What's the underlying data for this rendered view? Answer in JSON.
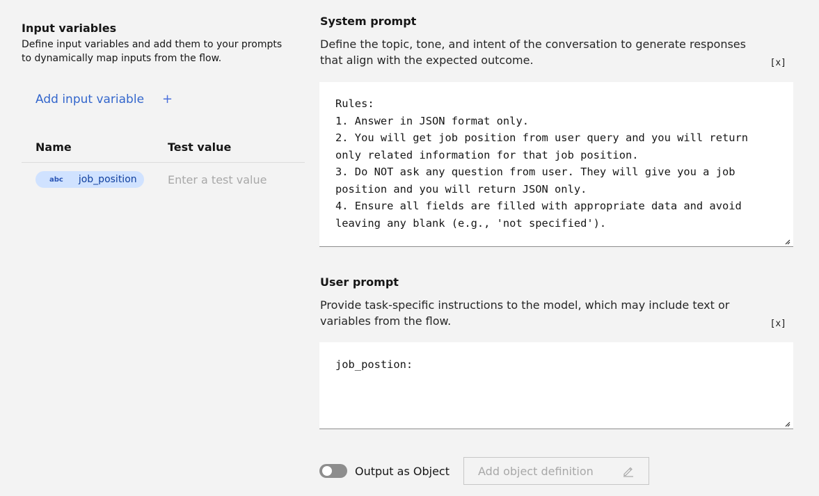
{
  "input_variables": {
    "title": "Input variables",
    "description": "Define input variables and add them to your prompts to dynamically map inputs from the flow.",
    "add_label": "Add input variable",
    "add_icon": "+",
    "columns": {
      "name": "Name",
      "test_value": "Test value"
    },
    "rows": [
      {
        "type_badge": "abc",
        "name": "job_position",
        "test_value_placeholder": "Enter a test value"
      }
    ]
  },
  "system_prompt": {
    "title": "System prompt",
    "description": "Define the topic, tone, and intent of the conversation to generate responses that align with the expected outcome.",
    "variable_icon": "[x]",
    "content": "Rules:\n1. Answer in JSON format only.\n2. You will get job position from user query and you will return only related information for that job position.\n3. Do NOT ask any question from user. They will give you a job position and you will return JSON only.\n4. Ensure all fields are filled with appropriate data and avoid leaving any blank (e.g., 'not specified')."
  },
  "user_prompt": {
    "title": "User prompt",
    "description": "Provide task-specific instructions to the model, which may include text or variables from the flow.",
    "variable_icon": "[x]",
    "content": "job_postion:"
  },
  "output": {
    "toggle_label": "Output as Object",
    "toggle_on": false,
    "object_definition_label": "Add object definition"
  },
  "colors": {
    "background": "#f3f3f3",
    "link": "#3366cc",
    "tag_bg": "#d0e2ff",
    "toggle_off": "#8d8d8d"
  }
}
